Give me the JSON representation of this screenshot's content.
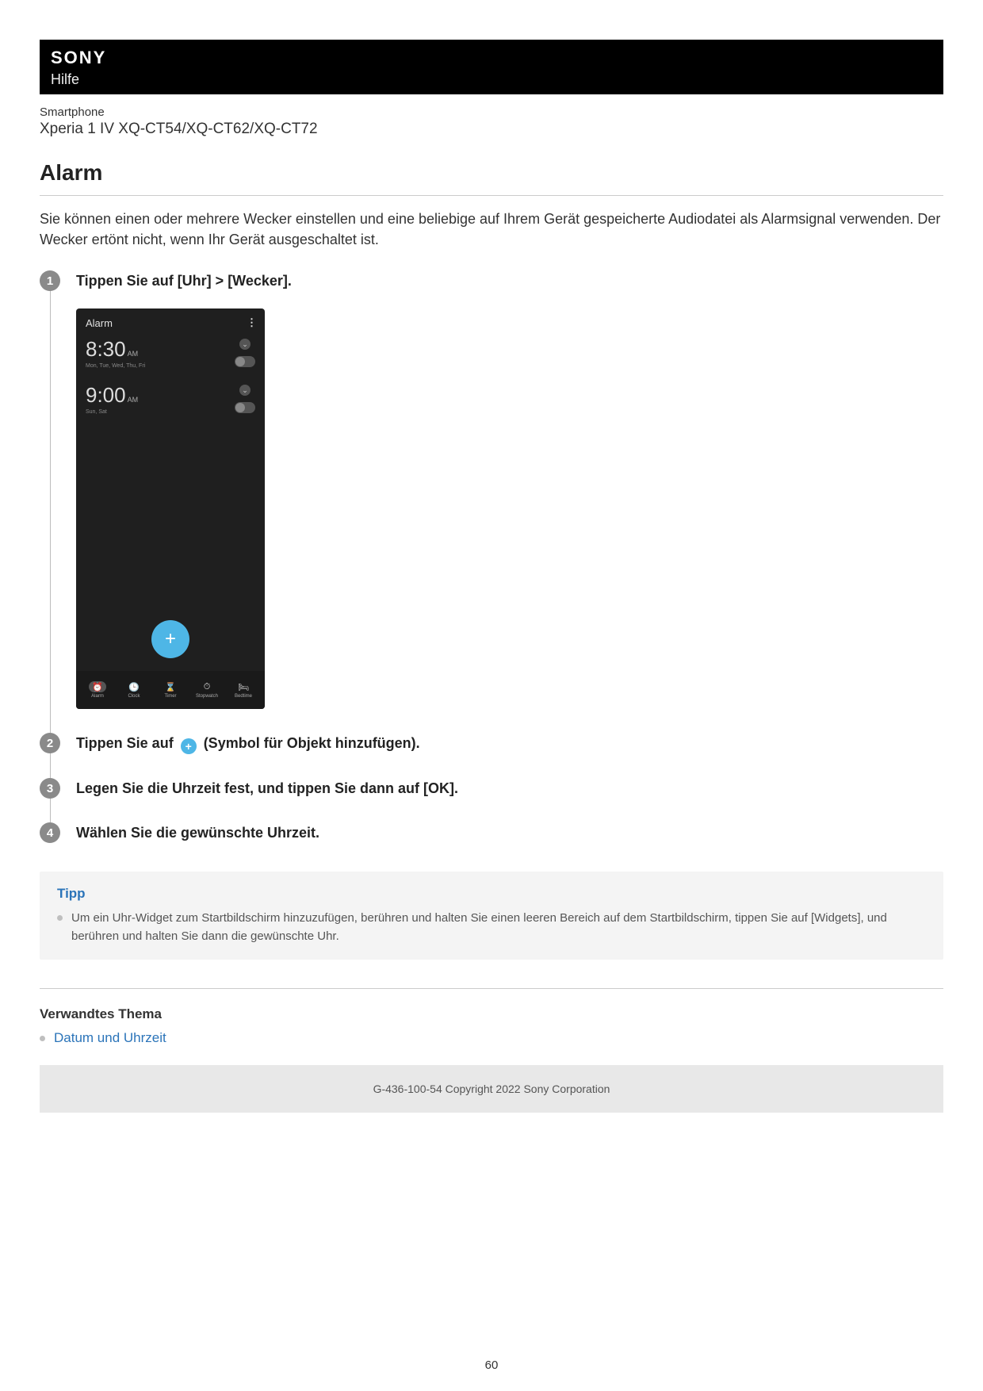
{
  "header": {
    "brand": "SONY",
    "help_label": "Hilfe",
    "device_category": "Smartphone",
    "device_model": "Xperia 1 IV XQ-CT54/XQ-CT62/XQ-CT72"
  },
  "page_title": "Alarm",
  "intro_text": "Sie können einen oder mehrere Wecker einstellen und eine beliebige auf Ihrem Gerät gespeicherte Audiodatei als Alarmsignal verwenden. Der Wecker ertönt nicht, wenn Ihr Gerät ausgeschaltet ist.",
  "steps": {
    "s1": {
      "num": "1",
      "title": "Tippen Sie auf [Uhr] > [Wecker]."
    },
    "s2": {
      "num": "2",
      "title_before": "Tippen Sie auf ",
      "title_after": " (Symbol für Objekt hinzufügen)."
    },
    "s3": {
      "num": "3",
      "title": "Legen Sie die Uhrzeit fest, und tippen Sie dann auf [OK]."
    },
    "s4": {
      "num": "4",
      "title": "Wählen Sie die gewünschte Uhrzeit."
    }
  },
  "phone": {
    "header_title": "Alarm",
    "kebab": "⋮",
    "alarms": {
      "a1": {
        "time": "8:30",
        "ampm": "AM",
        "days": "Mon, Tue, Wed, Thu, Fri"
      },
      "a2": {
        "time": "9:00",
        "ampm": "AM",
        "days": "Sun, Sat"
      }
    },
    "fab_plus": "+",
    "nav": {
      "alarm": "Alarm",
      "clock": "Clock",
      "timer": "Timer",
      "stopwatch": "Stopwatch",
      "bedtime": "Bedtime"
    }
  },
  "tip": {
    "heading": "Tipp",
    "item1": "Um ein Uhr-Widget zum Startbildschirm hinzuzufügen, berühren und halten Sie einen leeren Bereich auf dem Startbildschirm, tippen Sie auf [Widgets], und berühren und halten Sie dann die gewünschte Uhr."
  },
  "related": {
    "heading": "Verwandtes Thema",
    "link1": "Datum und Uhrzeit"
  },
  "footer_text": "G-436-100-54 Copyright 2022 Sony Corporation",
  "page_number": "60"
}
